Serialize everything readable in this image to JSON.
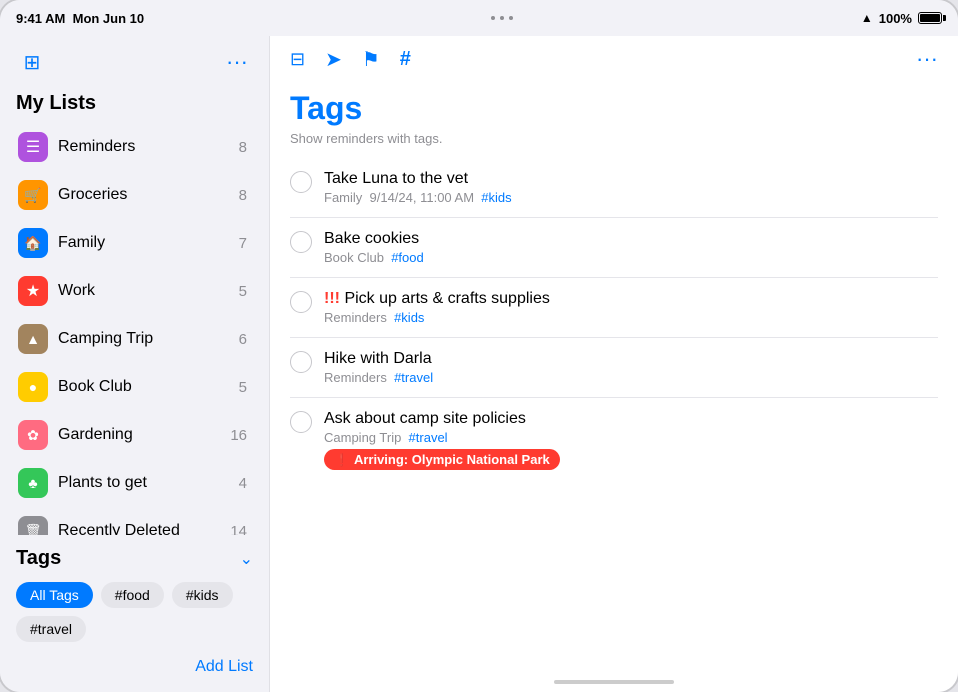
{
  "statusBar": {
    "time": "9:41 AM",
    "date": "Mon Jun 10",
    "battery": "100%"
  },
  "sidebar": {
    "myListsHeader": "My Lists",
    "lists": [
      {
        "id": "reminders",
        "label": "Reminders",
        "count": 8,
        "icon": "☰",
        "iconClass": "icon-purple"
      },
      {
        "id": "groceries",
        "label": "Groceries",
        "count": 8,
        "icon": "🛒",
        "iconClass": "icon-orange"
      },
      {
        "id": "family",
        "label": "Family",
        "count": 7,
        "icon": "🏠",
        "iconClass": "icon-blue"
      },
      {
        "id": "work",
        "label": "Work",
        "count": 5,
        "icon": "★",
        "iconClass": "icon-red"
      },
      {
        "id": "camping-trip",
        "label": "Camping Trip",
        "count": 6,
        "icon": "▲",
        "iconClass": "icon-brown"
      },
      {
        "id": "book-club",
        "label": "Book Club",
        "count": 5,
        "icon": "●",
        "iconClass": "icon-yellow"
      },
      {
        "id": "gardening",
        "label": "Gardening",
        "count": 16,
        "icon": "✿",
        "iconClass": "icon-pink"
      },
      {
        "id": "plants-to-get",
        "label": "Plants to get",
        "count": 4,
        "icon": "♣",
        "iconClass": "icon-green"
      },
      {
        "id": "recently-deleted",
        "label": "Recently Deleted",
        "count": 14,
        "icon": "🗑",
        "iconClass": "icon-gray"
      }
    ],
    "tagsSection": {
      "label": "Tags",
      "tags": [
        {
          "id": "all-tags",
          "label": "All Tags",
          "active": true
        },
        {
          "id": "food",
          "label": "#food",
          "active": false
        },
        {
          "id": "kids",
          "label": "#kids",
          "active": false
        },
        {
          "id": "travel",
          "label": "#travel",
          "active": false
        }
      ]
    },
    "addListLabel": "Add List"
  },
  "main": {
    "title": "Tags",
    "subtitle": "Show reminders with tags.",
    "reminders": [
      {
        "id": "take-luna",
        "title": "Take Luna to the vet",
        "meta": "Family",
        "date": "9/14/24, 11:00 AM",
        "tag": "#kids",
        "exclamation": false,
        "arriving": null
      },
      {
        "id": "bake-cookies",
        "title": "Bake cookies",
        "meta": "Book Club",
        "date": null,
        "tag": "#food",
        "exclamation": false,
        "arriving": null
      },
      {
        "id": "pick-up-arts",
        "title": "Pick up arts & crafts supplies",
        "meta": "Reminders",
        "date": null,
        "tag": "#kids",
        "exclamation": true,
        "exclamationText": "!!!",
        "arriving": null
      },
      {
        "id": "hike-darla",
        "title": "Hike with Darla",
        "meta": "Reminders",
        "date": null,
        "tag": "#travel",
        "exclamation": false,
        "arriving": null
      },
      {
        "id": "camp-policies",
        "title": "Ask about camp site policies",
        "meta": "Camping Trip",
        "date": null,
        "tag": "#travel",
        "exclamation": false,
        "arriving": "Olympic National Park"
      }
    ],
    "toolbar": {
      "moreLabel": "•••"
    }
  }
}
